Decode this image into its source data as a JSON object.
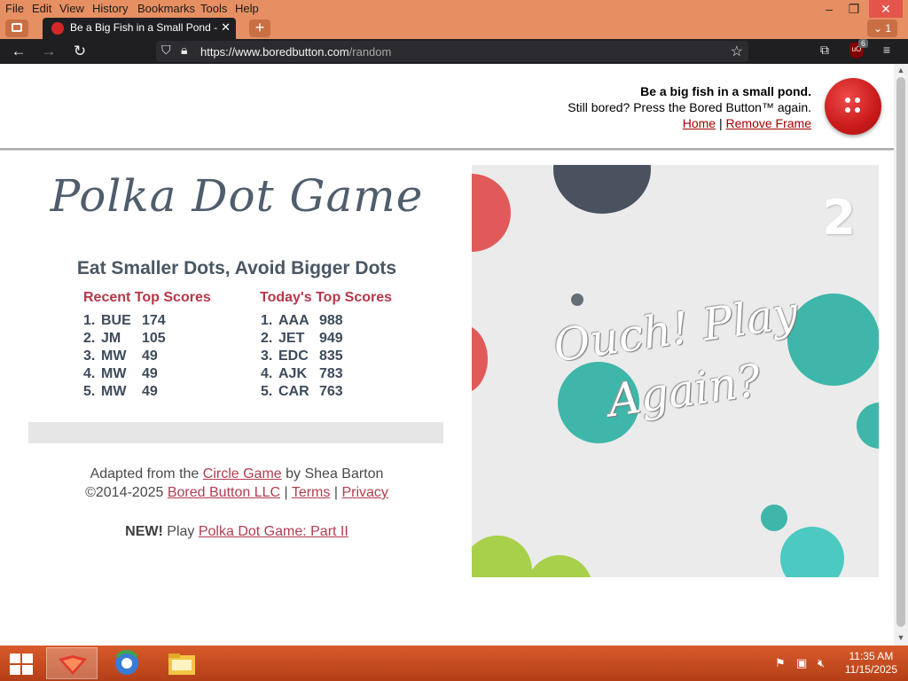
{
  "browser": {
    "menu": [
      "File",
      "Edit",
      "View",
      "History",
      "Bookmarks",
      "Tools",
      "Help"
    ],
    "tab_title": "Be a Big Fish in a Small Pond - B",
    "tab_close": "✕",
    "new_tab": "+",
    "all_tabs_label": "1",
    "url_host": "https://www.boredbutton.com",
    "url_path": "/random",
    "ublock_badge": "6"
  },
  "frame_header": {
    "tagline": "Be a big fish in a small pond.",
    "line2": "Still bored? Press the Bored Button™ again.",
    "home_link": "Home",
    "separator": "|",
    "remove_frame_link": "Remove Frame"
  },
  "game_info": {
    "title": "Polka Dot Game",
    "subtitle": "Eat Smaller Dots, Avoid Bigger Dots",
    "recent_heading": "Recent Top Scores",
    "today_heading": "Today's Top Scores",
    "recent_scores": [
      {
        "rank": "1.",
        "initials": "BUE",
        "score": "174"
      },
      {
        "rank": "2.",
        "initials": "JM",
        "score": "105"
      },
      {
        "rank": "3.",
        "initials": "MW",
        "score": "49"
      },
      {
        "rank": "4.",
        "initials": "MW",
        "score": "49"
      },
      {
        "rank": "5.",
        "initials": "MW",
        "score": "49"
      }
    ],
    "today_scores": [
      {
        "rank": "1.",
        "initials": "AAA",
        "score": "988"
      },
      {
        "rank": "2.",
        "initials": "JET",
        "score": "949"
      },
      {
        "rank": "3.",
        "initials": "EDC",
        "score": "835"
      },
      {
        "rank": "4.",
        "initials": "AJK",
        "score": "783"
      },
      {
        "rank": "5.",
        "initials": "CAR",
        "score": "763"
      }
    ]
  },
  "credits": {
    "adapted_prefix": "Adapted from the",
    "circle_game_link": "Circle Game",
    "adapted_suffix": "by Shea Barton",
    "copyright": "©2014-2025",
    "company_link": "Bored Button LLC",
    "pipe": "|",
    "terms_link": "Terms",
    "privacy_link": "Privacy",
    "new_label": "NEW!",
    "play_text": "Play",
    "part2_link": "Polka Dot Game: Part II"
  },
  "game": {
    "score": "2",
    "message": "Ouch! Play Again?",
    "dot_colors": {
      "red": "#e05a5a",
      "navy": "#4a5260",
      "teal": "#3fb6aa",
      "lime": "#a8d04a",
      "gray": "#666f78"
    }
  },
  "taskbar": {
    "time": "11:35 AM",
    "date": "11/15/2025"
  },
  "colors": {
    "menubar": "#e68f62",
    "accent_red": "#b5374a",
    "taskbar": "#c84a1f"
  }
}
